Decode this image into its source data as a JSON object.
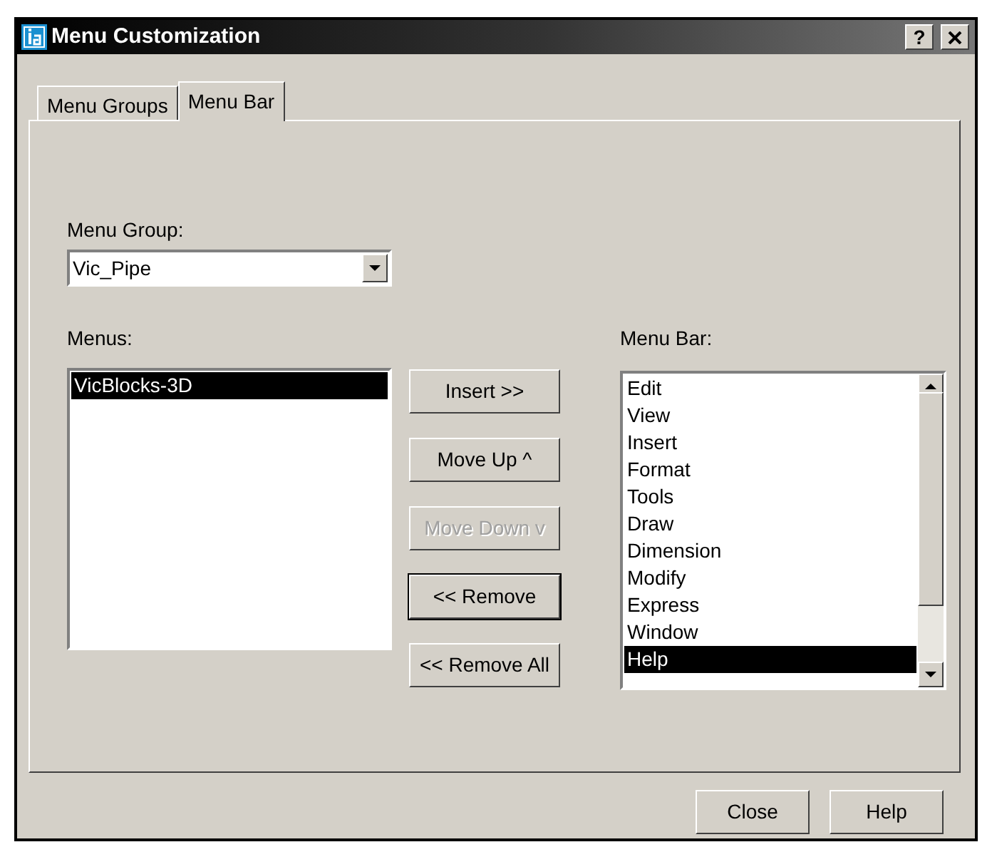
{
  "window": {
    "title": "Menu Customization",
    "help_button": "?"
  },
  "tabs": [
    {
      "label": "Menu Groups",
      "selected": false
    },
    {
      "label": "Menu Bar",
      "selected": true
    }
  ],
  "menu_group": {
    "label": "Menu Group:",
    "value": "Vic_Pipe"
  },
  "menus": {
    "label": "Menus:",
    "items": [
      {
        "text": "VicBlocks-3D",
        "selected": true
      }
    ]
  },
  "actions": [
    {
      "label": "Insert >>",
      "disabled": false,
      "default": false
    },
    {
      "label": "Move Up ^",
      "disabled": false,
      "default": false
    },
    {
      "label": "Move Down v",
      "disabled": true,
      "default": false
    },
    {
      "label": "<< Remove",
      "disabled": false,
      "default": true
    },
    {
      "label": "<< Remove All",
      "disabled": false,
      "default": false
    }
  ],
  "menu_bar": {
    "label": "Menu Bar:",
    "items": [
      {
        "text": "Edit",
        "selected": false
      },
      {
        "text": "View",
        "selected": false
      },
      {
        "text": "Insert",
        "selected": false
      },
      {
        "text": "Format",
        "selected": false
      },
      {
        "text": "Tools",
        "selected": false
      },
      {
        "text": "Draw",
        "selected": false
      },
      {
        "text": "Dimension",
        "selected": false
      },
      {
        "text": "Modify",
        "selected": false
      },
      {
        "text": "Express",
        "selected": false
      },
      {
        "text": "Window",
        "selected": false
      },
      {
        "text": "Help",
        "selected": true
      }
    ]
  },
  "footer_buttons": [
    "Close",
    "Help"
  ]
}
